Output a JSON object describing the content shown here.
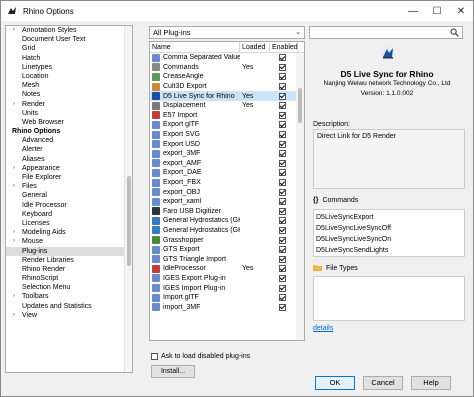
{
  "window": {
    "title": "Rhino Options",
    "minimize": "—",
    "maximize": "☐",
    "close": "✕"
  },
  "tree": [
    {
      "label": "Annotation Styles",
      "expander": "›",
      "level": 1
    },
    {
      "label": "Document User Text",
      "expander": "",
      "level": 1
    },
    {
      "label": "Grid",
      "expander": "",
      "level": 1
    },
    {
      "label": "Hatch",
      "expander": "",
      "level": 1
    },
    {
      "label": "Linetypes",
      "expander": "",
      "level": 1
    },
    {
      "label": "Location",
      "expander": "",
      "level": 1
    },
    {
      "label": "Mesh",
      "expander": "",
      "level": 1
    },
    {
      "label": "Notes",
      "expander": "",
      "level": 1
    },
    {
      "label": "Render",
      "expander": "›",
      "level": 1
    },
    {
      "label": "Units",
      "expander": "",
      "level": 1
    },
    {
      "label": "Web Browser",
      "expander": "",
      "level": 1
    },
    {
      "label": "Rhino Options",
      "expander": "",
      "level": 0
    },
    {
      "label": "Advanced",
      "expander": "",
      "level": 1
    },
    {
      "label": "Alerter",
      "expander": "",
      "level": 1
    },
    {
      "label": "Aliases",
      "expander": "",
      "level": 1
    },
    {
      "label": "Appearance",
      "expander": "›",
      "level": 1
    },
    {
      "label": "File Explorer",
      "expander": "",
      "level": 1
    },
    {
      "label": "Files",
      "expander": "›",
      "level": 1
    },
    {
      "label": "General",
      "expander": "",
      "level": 1
    },
    {
      "label": "Idle Processor",
      "expander": "",
      "level": 1
    },
    {
      "label": "Keyboard",
      "expander": "",
      "level": 1
    },
    {
      "label": "Licenses",
      "expander": "",
      "level": 1
    },
    {
      "label": "Modeling Aids",
      "expander": "›",
      "level": 1
    },
    {
      "label": "Mouse",
      "expander": "›",
      "level": 1
    },
    {
      "label": "Plug-ins",
      "expander": "",
      "level": 1,
      "selected": true
    },
    {
      "label": "Render Libraries",
      "expander": "",
      "level": 1
    },
    {
      "label": "Rhino Render",
      "expander": "",
      "level": 1
    },
    {
      "label": "RhinoScript",
      "expander": "",
      "level": 1
    },
    {
      "label": "Selection Menu",
      "expander": "",
      "level": 1
    },
    {
      "label": "Toolbars",
      "expander": "›",
      "level": 1
    },
    {
      "label": "Updates and Statistics",
      "expander": "",
      "level": 1
    },
    {
      "label": "View",
      "expander": "›",
      "level": 1
    }
  ],
  "filter": {
    "value": "All Plug-ins",
    "chevron": "⌄"
  },
  "search": {
    "placeholder": ""
  },
  "columns": {
    "name": "Name",
    "loaded": "Loaded",
    "enabled": "Enabled"
  },
  "plugins": [
    {
      "name": "Comma Separated Value",
      "loaded": "",
      "enabled": true,
      "color": "#6a8ac8"
    },
    {
      "name": "Commands",
      "loaded": "Yes",
      "enabled": true,
      "color": "#888888"
    },
    {
      "name": "CreaseAngle",
      "loaded": "",
      "enabled": true,
      "color": "#5a9a5a"
    },
    {
      "name": "Cult3D Export",
      "loaded": "",
      "enabled": true,
      "color": "#c88a3a"
    },
    {
      "name": "D5 Live Sync for Rhino",
      "loaded": "Yes",
      "enabled": true,
      "color": "#1a4fa0",
      "selected": true
    },
    {
      "name": "Displacement",
      "loaded": "Yes",
      "enabled": true,
      "color": "#7a7a7a"
    },
    {
      "name": "E57 Import",
      "loaded": "",
      "enabled": true,
      "color": "#c04040"
    },
    {
      "name": "Export glTF",
      "loaded": "",
      "enabled": true,
      "color": "#6a8ac8"
    },
    {
      "name": "Export SVG",
      "loaded": "",
      "enabled": true,
      "color": "#6a8ac8"
    },
    {
      "name": "Export USD",
      "loaded": "",
      "enabled": true,
      "color": "#6a8ac8"
    },
    {
      "name": "export_3MF",
      "loaded": "",
      "enabled": true,
      "color": "#6a8ac8"
    },
    {
      "name": "export_AMF",
      "loaded": "",
      "enabled": true,
      "color": "#6a8ac8"
    },
    {
      "name": "Export_DAE",
      "loaded": "",
      "enabled": true,
      "color": "#6a8ac8"
    },
    {
      "name": "Export_FBX",
      "loaded": "",
      "enabled": true,
      "color": "#6a8ac8"
    },
    {
      "name": "export_OBJ",
      "loaded": "",
      "enabled": true,
      "color": "#6a8ac8"
    },
    {
      "name": "export_xaml",
      "loaded": "",
      "enabled": true,
      "color": "#6a8ac8"
    },
    {
      "name": "Faro USB Digitizer",
      "loaded": "",
      "enabled": true,
      "color": "#333333"
    },
    {
      "name": "General Hydrostatics (GH",
      "loaded": "",
      "enabled": true,
      "color": "#3a7ac0"
    },
    {
      "name": "General Hydrostatics (GH",
      "loaded": "",
      "enabled": true,
      "color": "#3a7ac0"
    },
    {
      "name": "Grasshopper",
      "loaded": "",
      "enabled": true,
      "color": "#4a8a3a"
    },
    {
      "name": "GTS Export",
      "loaded": "",
      "enabled": true,
      "color": "#6a8ac8"
    },
    {
      "name": "GTS Triangle Import",
      "loaded": "",
      "enabled": true,
      "color": "#6a8ac8"
    },
    {
      "name": "IdleProcessor",
      "loaded": "Yes",
      "enabled": true,
      "color": "#c04040"
    },
    {
      "name": "IGES Export Plug-in",
      "loaded": "",
      "enabled": true,
      "color": "#6a8ac8"
    },
    {
      "name": "IGES Import Plug-in",
      "loaded": "",
      "enabled": true,
      "color": "#6a8ac8"
    },
    {
      "name": "Import glTF",
      "loaded": "",
      "enabled": true,
      "color": "#6a8ac8"
    },
    {
      "name": "import_3MF",
      "loaded": "",
      "enabled": true,
      "color": "#6a8ac8"
    }
  ],
  "install_label": "Install...",
  "ask_label": "Ask to load disabled plug-ins",
  "details": {
    "name": "D5 Live Sync for Rhino",
    "company": "Nanjing Weiwu network Technology Co., Ltd",
    "version": "Version: 1.1.0.002",
    "description_label": "Description:",
    "description": "Direct Link for D5 Render",
    "commands_label": "Commands",
    "commands": [
      "D5LiveSyncExport",
      "D5LiveSyncLiveSyncOff",
      "D5LiveSyncLiveSyncOn",
      "D5LiveSyncSendLights"
    ],
    "filetypes_label": "File Types",
    "link": "details"
  },
  "buttons": {
    "ok": "OK",
    "cancel": "Cancel",
    "help": "Help"
  }
}
